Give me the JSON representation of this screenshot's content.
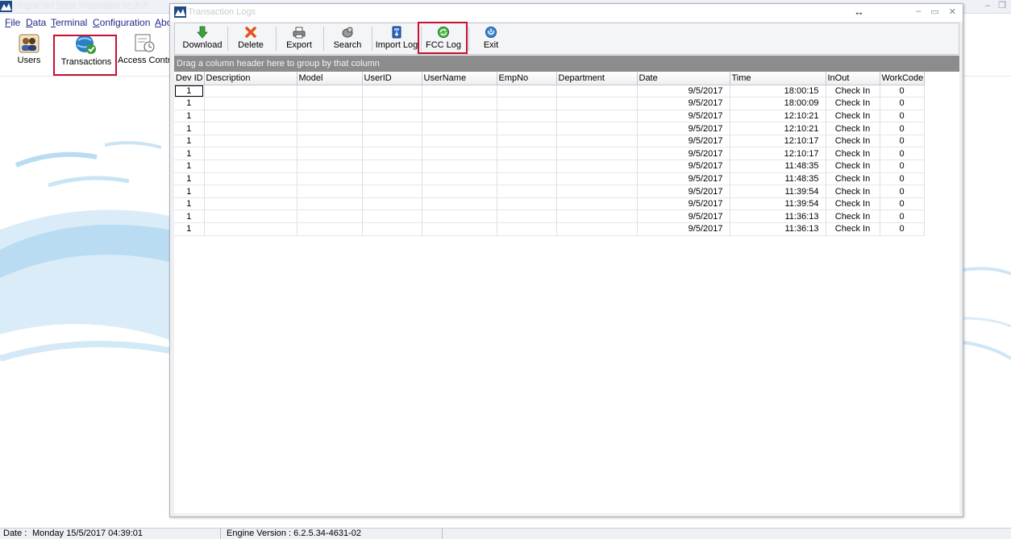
{
  "app": {
    "title": "FingerTec Data Processor v1.8.3",
    "menu": [
      "File",
      "Data",
      "Terminal",
      "Configuration",
      "Abo"
    ],
    "toolbar": [
      {
        "label": "Users",
        "icon": "users-icon"
      },
      {
        "label": "Transactions",
        "icon": "transactions-icon",
        "highlighted": true
      },
      {
        "label": "Access Contro",
        "icon": "access-control-icon"
      }
    ],
    "status": {
      "date_label": "Date :",
      "date_value": "Monday   15/5/2017 04:39:01",
      "engine": "Engine Version : 6.2.5.34-4631-02"
    }
  },
  "window": {
    "title": "Transaction Logs",
    "resize_glyph": "↔",
    "toolbar": [
      {
        "label": "Download",
        "icon": "download-arrow-icon"
      },
      {
        "label": "Delete",
        "icon": "delete-x-icon"
      },
      {
        "label": "Export",
        "icon": "export-printer-icon"
      },
      {
        "label": "Search",
        "icon": "search-icon"
      },
      {
        "label": "Import Log",
        "icon": "import-log-icon"
      },
      {
        "label": "FCC Log",
        "icon": "fcc-log-icon",
        "highlighted": true
      },
      {
        "label": "Exit",
        "icon": "exit-icon"
      }
    ],
    "group_hint": "Drag a column header here to group by that column",
    "columns": [
      "Dev ID",
      "Description",
      "Model",
      "UserID",
      "UserName",
      "EmpNo",
      "Department",
      "Date",
      "Time",
      "InOut",
      "WorkCode"
    ],
    "rows": [
      {
        "dev_id": "1",
        "date": "9/5/2017",
        "time": "18:00:15",
        "inout": "Check In",
        "workcode": "0"
      },
      {
        "dev_id": "1",
        "date": "9/5/2017",
        "time": "18:00:09",
        "inout": "Check In",
        "workcode": "0"
      },
      {
        "dev_id": "1",
        "date": "9/5/2017",
        "time": "12:10:21",
        "inout": "Check In",
        "workcode": "0"
      },
      {
        "dev_id": "1",
        "date": "9/5/2017",
        "time": "12:10:21",
        "inout": "Check In",
        "workcode": "0"
      },
      {
        "dev_id": "1",
        "date": "9/5/2017",
        "time": "12:10:17",
        "inout": "Check In",
        "workcode": "0"
      },
      {
        "dev_id": "1",
        "date": "9/5/2017",
        "time": "12:10:17",
        "inout": "Check In",
        "workcode": "0"
      },
      {
        "dev_id": "1",
        "date": "9/5/2017",
        "time": "11:48:35",
        "inout": "Check In",
        "workcode": "0"
      },
      {
        "dev_id": "1",
        "date": "9/5/2017",
        "time": "11:48:35",
        "inout": "Check In",
        "workcode": "0"
      },
      {
        "dev_id": "1",
        "date": "9/5/2017",
        "time": "11:39:54",
        "inout": "Check In",
        "workcode": "0"
      },
      {
        "dev_id": "1",
        "date": "9/5/2017",
        "time": "11:39:54",
        "inout": "Check In",
        "workcode": "0"
      },
      {
        "dev_id": "1",
        "date": "9/5/2017",
        "time": "11:36:13",
        "inout": "Check In",
        "workcode": "0"
      },
      {
        "dev_id": "1",
        "date": "9/5/2017",
        "time": "11:36:13",
        "inout": "Check In",
        "workcode": "0"
      }
    ]
  },
  "colors": {
    "highlight": "#c8102e",
    "group_panel": "#8c8c8c",
    "menu_text": "#1e2a88"
  }
}
